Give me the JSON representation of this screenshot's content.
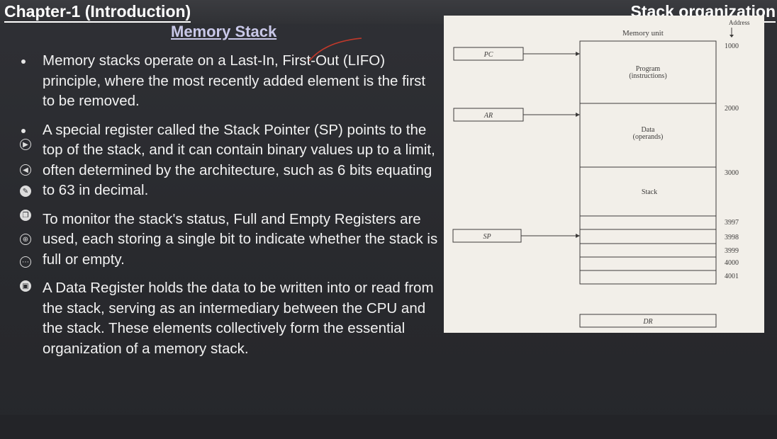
{
  "header": {
    "chapter_title": "Chapter-1 (Introduction)",
    "topic_title": "Stack organization"
  },
  "slide": {
    "subtitle": "Memory Stack",
    "bullets": [
      "Memory stacks operate on a Last-In, First-Out (LIFO) principle, where the most recently added element is the first to be removed.",
      "A special register called the Stack Pointer (SP) points to the top of the stack, and it can contain binary values up to a limit, often determined by the architecture, such as 6 bits equating to 63 in decimal.",
      "To monitor the stack's status, Full and Empty Registers are used, each storing a single bit to indicate whether the stack is full or empty.",
      "A Data Register holds the data to be written into or read from the stack, serving as an intermediary between the CPU and the stack. These elements collectively form the essential organization of a memory stack."
    ]
  },
  "diagram": {
    "memory_unit_label": "Memory unit",
    "address_label": "Address",
    "registers": {
      "pc": "PC",
      "ar": "AR",
      "sp": "SP",
      "dr": "DR"
    },
    "segments": {
      "program_line1": "Program",
      "program_line2": "(instructions)",
      "data_line1": "Data",
      "data_line2": "(operands)",
      "stack": "Stack"
    },
    "addresses": [
      "1000",
      "2000",
      "3000",
      "3997",
      "3998",
      "3999",
      "4000",
      "4001"
    ]
  },
  "colors": {
    "accent_subtitle": "#c9c8e8",
    "annotation_red": "#c0392b",
    "diagram_bg": "#f2efe9"
  }
}
